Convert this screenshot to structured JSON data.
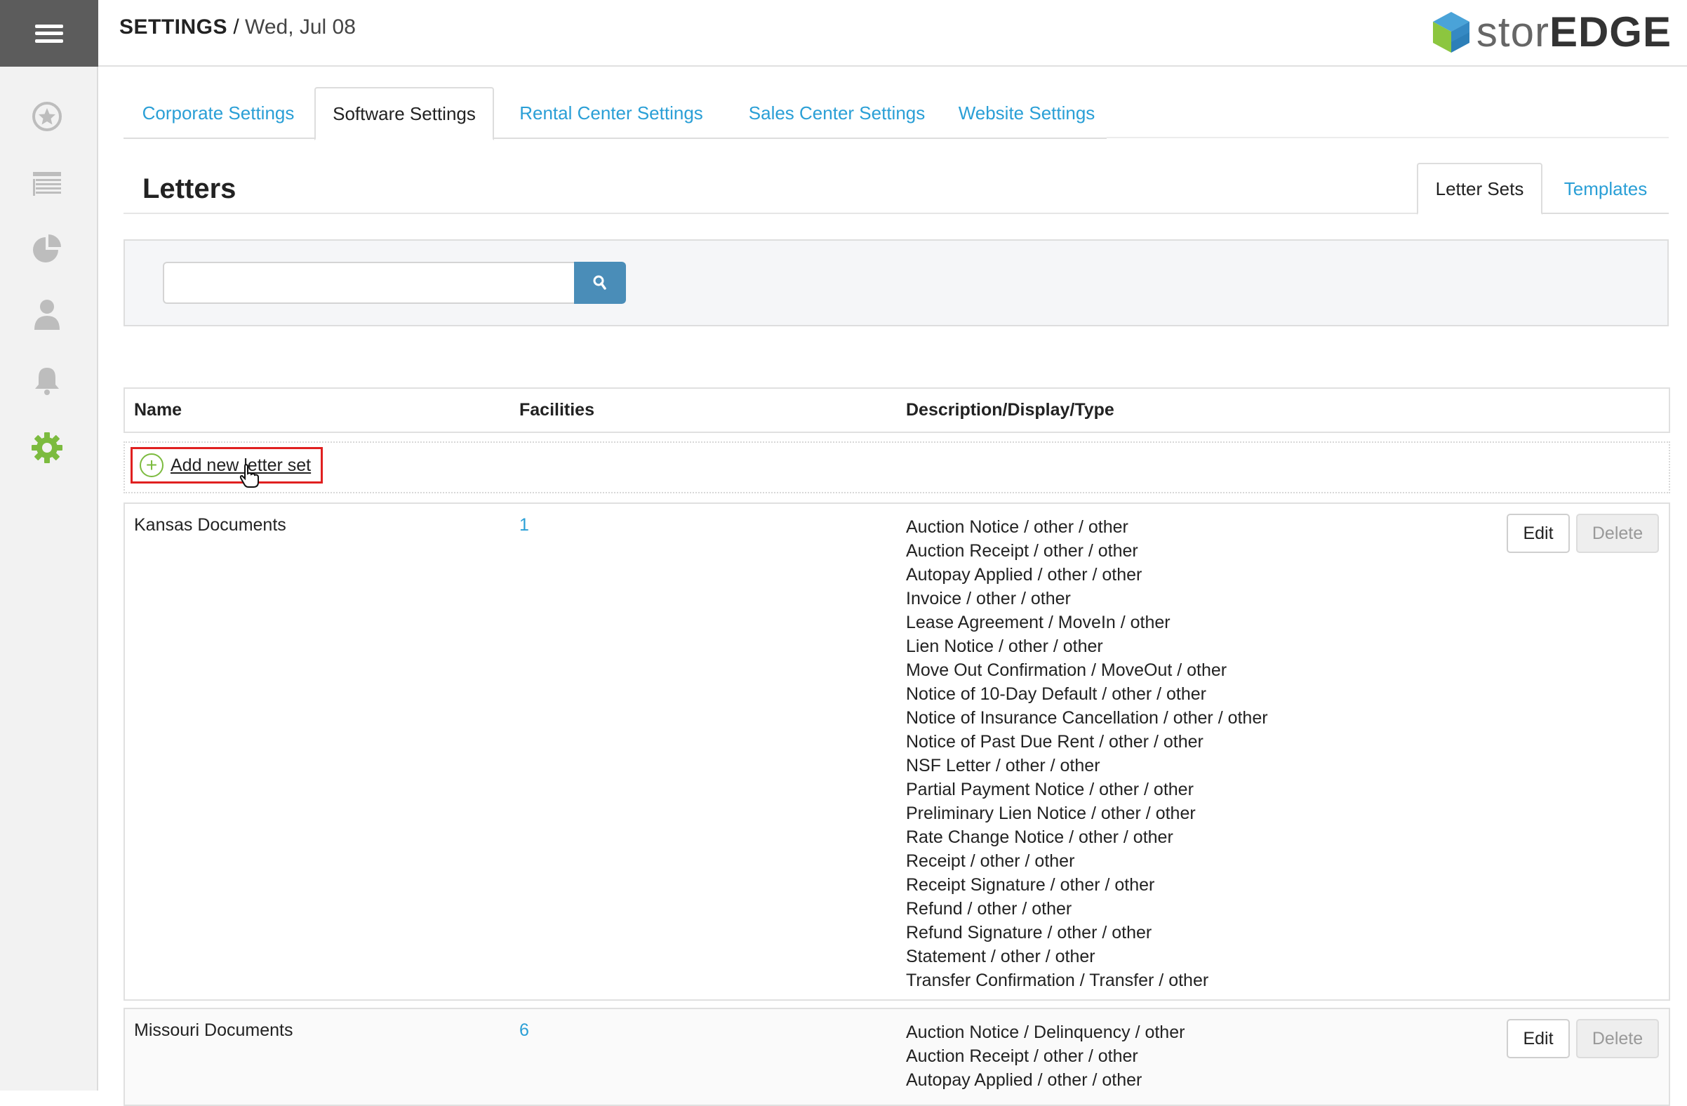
{
  "header": {
    "section": "SETTINGS",
    "separator": "/",
    "date": "Wed, Jul 08",
    "logo_light": "stor",
    "logo_bold": "EDGE"
  },
  "sidebar": {
    "icons": [
      "menu-icon",
      "star-icon",
      "list-icon",
      "pie-chart-icon",
      "user-icon",
      "bell-icon",
      "gear-icon"
    ],
    "active_color": "#7cbb3f"
  },
  "tabs": [
    {
      "label": "Corporate Settings",
      "active": false
    },
    {
      "label": "Software Settings",
      "active": true
    },
    {
      "label": "Rental Center Settings",
      "active": false
    },
    {
      "label": "Sales Center Settings",
      "active": false
    },
    {
      "label": "Website Settings",
      "active": false
    }
  ],
  "page": {
    "title": "Letters",
    "subtabs": [
      {
        "label": "Letter Sets",
        "active": true
      },
      {
        "label": "Templates",
        "active": false
      }
    ]
  },
  "search": {
    "value": "",
    "button_icon": "search-icon"
  },
  "table": {
    "columns": [
      "Name",
      "Facilities",
      "Description/Display/Type"
    ],
    "add_label": "Add new letter set",
    "edit_label": "Edit",
    "delete_label": "Delete",
    "rows": [
      {
        "name": "Kansas Documents",
        "facilities": "1",
        "descriptions": [
          "Auction Notice / other / other",
          "Auction Receipt / other / other",
          "Autopay Applied / other / other",
          "Invoice / other / other",
          "Lease Agreement / MoveIn / other",
          "Lien Notice / other / other",
          "Move Out Confirmation / MoveOut / other",
          "Notice of 10-Day Default / other / other",
          "Notice of Insurance Cancellation / other / other",
          "Notice of Past Due Rent / other / other",
          "NSF Letter / other / other",
          "Partial Payment Notice / other / other",
          "Preliminary Lien Notice / other / other",
          "Rate Change Notice / other / other",
          "Receipt / other / other",
          "Receipt Signature / other / other",
          "Refund / other / other",
          "Refund Signature / other / other",
          "Statement / other / other",
          "Transfer Confirmation / Transfer / other"
        ]
      },
      {
        "name": "Missouri Documents",
        "facilities": "6",
        "descriptions": [
          "Auction Notice / Delinquency / other",
          "Auction Receipt / other / other",
          "Autopay Applied / other / other"
        ]
      }
    ]
  },
  "colors": {
    "link": "#2a9fd6",
    "search_button": "#4a8db8",
    "highlight_border": "#e02020",
    "add_icon": "#7cbb3f"
  }
}
